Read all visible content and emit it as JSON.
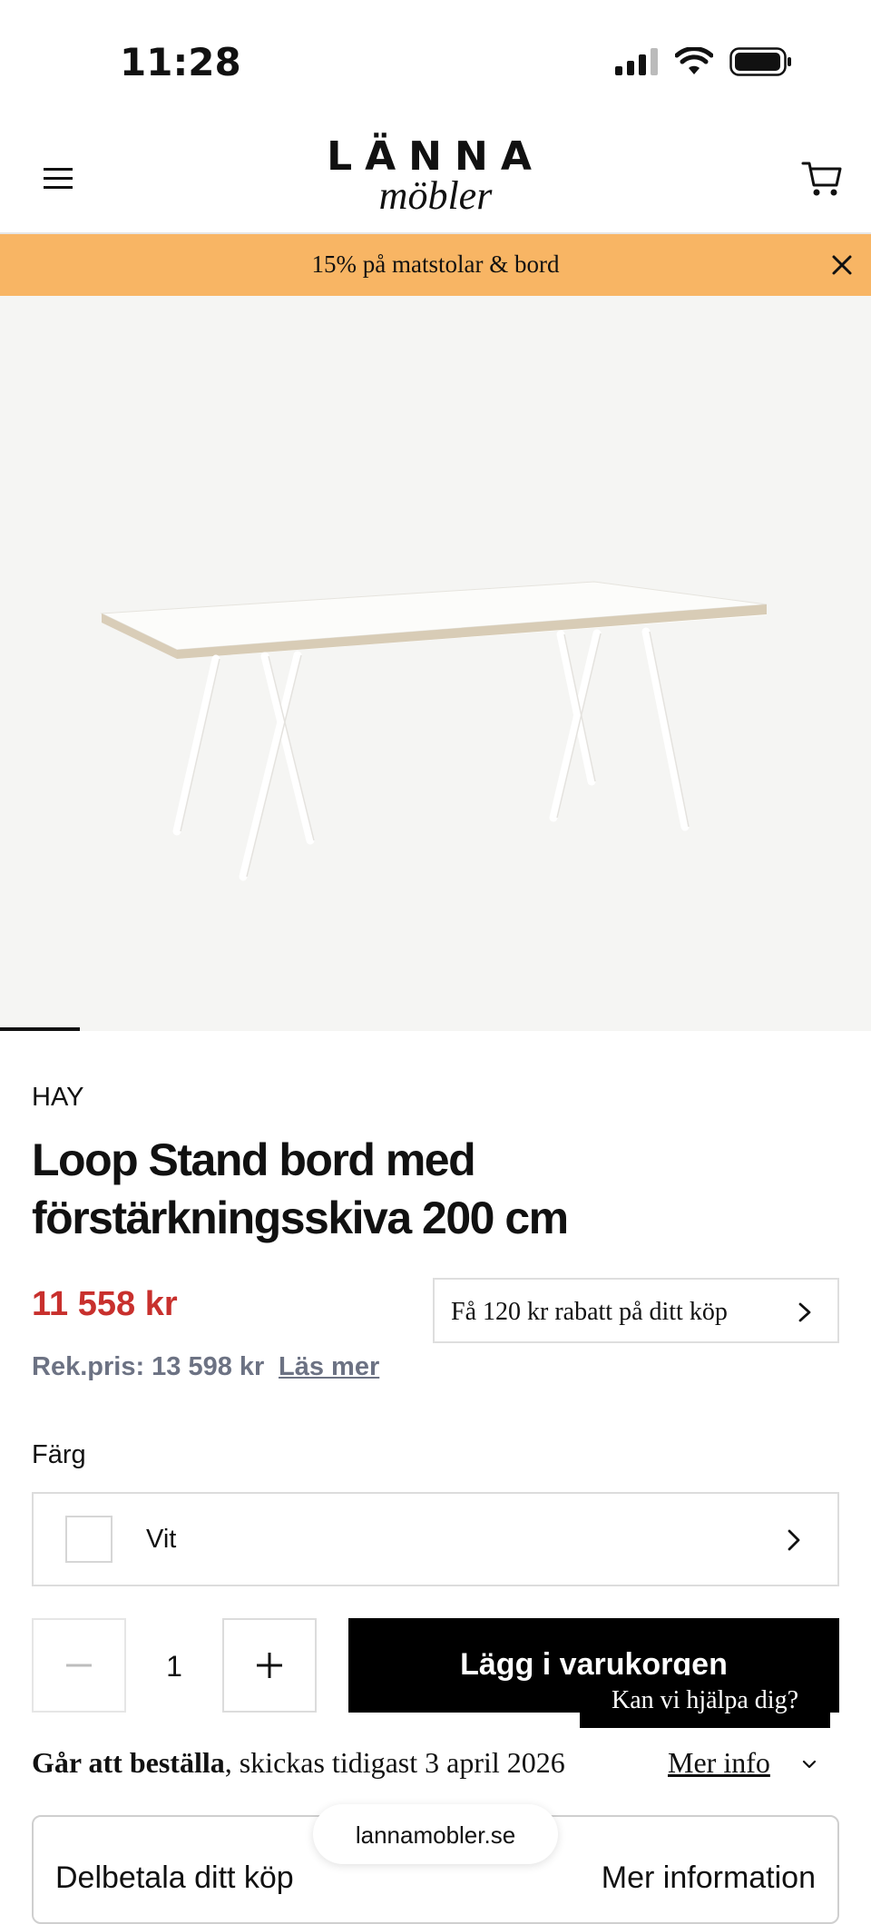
{
  "status_bar": {
    "time": "11:28"
  },
  "header": {
    "logo_top": "LÄNNA",
    "logo_bottom": "möbler"
  },
  "promo": {
    "text": "15% på matstolar & bord"
  },
  "gallery": {
    "image_alt": "Loop Stand bord",
    "active_index": 1
  },
  "product": {
    "brand": "HAY",
    "title": "Loop Stand bord med förstärkningsskiva 200 cm",
    "price": "11 558 kr",
    "discount_label": "Få 120 kr rabatt på ditt köp",
    "recommended_price": "Rek.pris: 13 598 kr",
    "read_more": "Läs mer"
  },
  "options": {
    "color_label": "Färg",
    "color_value": "Vit"
  },
  "purchase": {
    "quantity": "1",
    "add_to_cart": "Lägg i varukorgen"
  },
  "help_chat": {
    "label": "Kan vi hjälpa dig?"
  },
  "shipping": {
    "available": "Går att beställa",
    "dispatch": ", skickas tidigast 3 april 2026",
    "more_info": "Mer info"
  },
  "installment": {
    "label": "Delbetala ditt köp",
    "link": "Mer information"
  },
  "browser": {
    "url": "lannamobler.se"
  },
  "colors": {
    "promo_bg": "#f8b564",
    "price_red": "#c8302d",
    "muted": "#6c7283"
  }
}
